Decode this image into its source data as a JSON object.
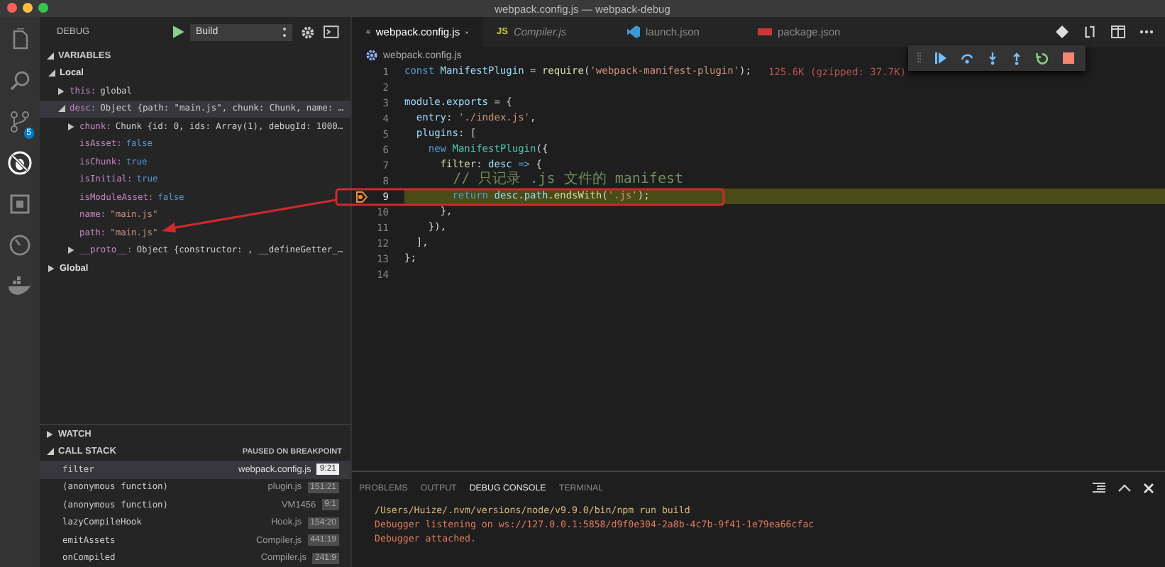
{
  "window": {
    "title": "webpack.config.js — webpack-debug"
  },
  "activity_bar": [
    {
      "kind": "files",
      "selected": false
    },
    {
      "kind": "search",
      "selected": false
    },
    {
      "kind": "scm",
      "selected": false,
      "badge": "5"
    },
    {
      "kind": "debug",
      "selected": true
    },
    {
      "kind": "extensions",
      "selected": false
    },
    {
      "kind": "gauge",
      "selected": false
    },
    {
      "kind": "docker",
      "selected": false
    }
  ],
  "debug_header": {
    "title": "DEBUG",
    "configuration": "Build"
  },
  "variables": {
    "title": "VARIABLES",
    "expanded": true,
    "scopes": [
      {
        "name": "Local",
        "kind": "scope",
        "expanded": true,
        "selected": false,
        "children": [
          {
            "name": "this:",
            "value": "global",
            "kind": "object",
            "expanded": false,
            "selected": false
          },
          {
            "name": "desc:",
            "value": "Object {path: \"main.js\", chunk: Chunk, name: …",
            "kind": "object",
            "expanded": true,
            "selected": true,
            "children": [
              {
                "name": "chunk:",
                "value": "Chunk {id: 0, ids: Array(1), debugId: 1000…",
                "kind": "object",
                "expanded": false,
                "selected": false
              },
              {
                "name": "isAsset:",
                "value": "false",
                "kind": "boolean",
                "selected": false
              },
              {
                "name": "isChunk:",
                "value": "true",
                "kind": "boolean",
                "selected": false
              },
              {
                "name": "isInitial:",
                "value": "true",
                "kind": "boolean",
                "selected": false
              },
              {
                "name": "isModuleAsset:",
                "value": "false",
                "kind": "boolean",
                "selected": false
              },
              {
                "name": "name:",
                "value": "\"main.js\"",
                "kind": "string",
                "selected": false
              },
              {
                "name": "path:",
                "value": "\"main.js\"",
                "kind": "string",
                "selected": false
              },
              {
                "name": "__proto__:",
                "value": "Object {constructor: , __defineGetter_…",
                "kind": "object",
                "expanded": false,
                "selected": false
              }
            ]
          }
        ]
      },
      {
        "name": "Global",
        "kind": "scope",
        "expanded": false,
        "selected": false
      }
    ]
  },
  "watch": {
    "title": "WATCH",
    "expanded": false
  },
  "call_stack": {
    "title": "CALL STACK",
    "status": "PAUSED ON BREAKPOINT",
    "expanded": true,
    "frames": [
      {
        "name": "filter",
        "file": "webpack.config.js",
        "location": "9:21",
        "selected": true
      },
      {
        "name": "(anonymous function)",
        "file": "plugin.js",
        "location": "151:21",
        "selected": false
      },
      {
        "name": "(anonymous function)",
        "file": "VM1456",
        "location": "9:1",
        "selected": false
      },
      {
        "name": "lazyCompileHook",
        "file": "Hook.js",
        "location": "154:20",
        "selected": false
      },
      {
        "name": "emitAssets",
        "file": "Compiler.js",
        "location": "441:19",
        "selected": false
      },
      {
        "name": "onCompiled",
        "file": "Compiler.js",
        "location": "241:9",
        "selected": false
      }
    ]
  },
  "editor_tabs": [
    {
      "label": "webpack.config.js",
      "kind": "config",
      "selected": true,
      "preview": false
    },
    {
      "label": "Compiler.js",
      "kind": "js",
      "icon_text": "JS",
      "selected": false,
      "preview": true
    },
    {
      "label": "launch.json",
      "kind": "vscode",
      "selected": false,
      "preview": false
    },
    {
      "label": "package.json",
      "kind": "npm",
      "selected": false,
      "preview": false
    }
  ],
  "breadcrumb": "webpack.config.js",
  "code": {
    "lines": [
      {
        "number": "1",
        "breakpoint": false,
        "current": false,
        "tokens": [
          {
            "text": "const",
            "kind": "kw"
          },
          {
            "text": " ManifestPlugin",
            "kind": "var"
          },
          {
            "text": " = ",
            "kind": "p"
          },
          {
            "text": "require",
            "kind": "fn"
          },
          {
            "text": "(",
            "kind": "p"
          },
          {
            "text": "'webpack-manifest-plugin'",
            "kind": "str"
          },
          {
            "text": ");",
            "kind": "p"
          }
        ],
        "annotation": "125.6K (gzipped: 37.7K)"
      },
      {
        "number": "2",
        "breakpoint": false,
        "current": false
      },
      {
        "number": "3",
        "breakpoint": false,
        "current": false,
        "tokens": [
          {
            "text": "module",
            "kind": "var"
          },
          {
            "text": ".",
            "kind": "p"
          },
          {
            "text": "exports",
            "kind": "var"
          },
          {
            "text": " = {",
            "kind": "p"
          }
        ]
      },
      {
        "number": "4",
        "breakpoint": false,
        "current": false,
        "tokens": [
          {
            "text": "  entry",
            "kind": "var"
          },
          {
            "text": ": ",
            "kind": "p"
          },
          {
            "text": "'./index.js'",
            "kind": "str"
          },
          {
            "text": ",",
            "kind": "p"
          }
        ]
      },
      {
        "number": "5",
        "breakpoint": false,
        "current": false,
        "tokens": [
          {
            "text": "  plugins",
            "kind": "var"
          },
          {
            "text": ": [",
            "kind": "p"
          }
        ]
      },
      {
        "number": "6",
        "breakpoint": false,
        "current": false,
        "tokens": [
          {
            "text": "    new",
            "kind": "kw"
          },
          {
            "text": " ManifestPlugin",
            "kind": "cls"
          },
          {
            "text": "({",
            "kind": "p"
          }
        ]
      },
      {
        "number": "7",
        "breakpoint": false,
        "current": false,
        "tokens": [
          {
            "text": "      filter",
            "kind": "fn"
          },
          {
            "text": ": ",
            "kind": "p"
          },
          {
            "text": "desc",
            "kind": "var"
          },
          {
            "text": " =>",
            "kind": "kw"
          },
          {
            "text": " {",
            "kind": "p"
          }
        ]
      },
      {
        "number": "8",
        "breakpoint": false,
        "current": false,
        "tokens": [
          {
            "text": "        // 只记录 .js 文件的 manifest",
            "kind": "cmt"
          }
        ]
      },
      {
        "number": "9",
        "breakpoint": true,
        "current": true,
        "tokens": [
          {
            "text": "        return",
            "kind": "kw"
          },
          {
            "text": " desc",
            "kind": "var"
          },
          {
            "text": ".",
            "kind": "p"
          },
          {
            "text": "path",
            "kind": "var"
          },
          {
            "text": ".",
            "kind": "p"
          },
          {
            "text": "endsWith",
            "kind": "fn"
          },
          {
            "text": "(",
            "kind": "p"
          },
          {
            "text": "'.js'",
            "kind": "str"
          },
          {
            "text": ");",
            "kind": "p"
          }
        ]
      },
      {
        "number": "10",
        "breakpoint": false,
        "current": false,
        "tokens": [
          {
            "text": "      },",
            "kind": "p"
          }
        ]
      },
      {
        "number": "11",
        "breakpoint": false,
        "current": false,
        "tokens": [
          {
            "text": "    }),",
            "kind": "p"
          }
        ]
      },
      {
        "number": "12",
        "breakpoint": false,
        "current": false,
        "tokens": [
          {
            "text": "  ],",
            "kind": "p"
          }
        ]
      },
      {
        "number": "13",
        "breakpoint": false,
        "current": false,
        "tokens": [
          {
            "text": "};",
            "kind": "p"
          }
        ]
      },
      {
        "number": "14",
        "breakpoint": false,
        "current": false
      }
    ]
  },
  "panel": {
    "tabs": [
      {
        "label": "PROBLEMS",
        "selected": false
      },
      {
        "label": "OUTPUT",
        "selected": false
      },
      {
        "label": "DEBUG CONSOLE",
        "selected": true
      },
      {
        "label": "TERMINAL",
        "selected": false
      }
    ],
    "lines": [
      {
        "text": "/Users/Huize/.nvm/versions/node/v9.9.0/bin/npm run build",
        "kind": "command"
      },
      {
        "text": "Debugger listening on ws://127.0.0.1:5858/d9f0e304-2a8b-4c7b-9f41-1e79ea66cfac",
        "kind": "info"
      },
      {
        "text": "Debugger attached.",
        "kind": "info"
      }
    ]
  }
}
